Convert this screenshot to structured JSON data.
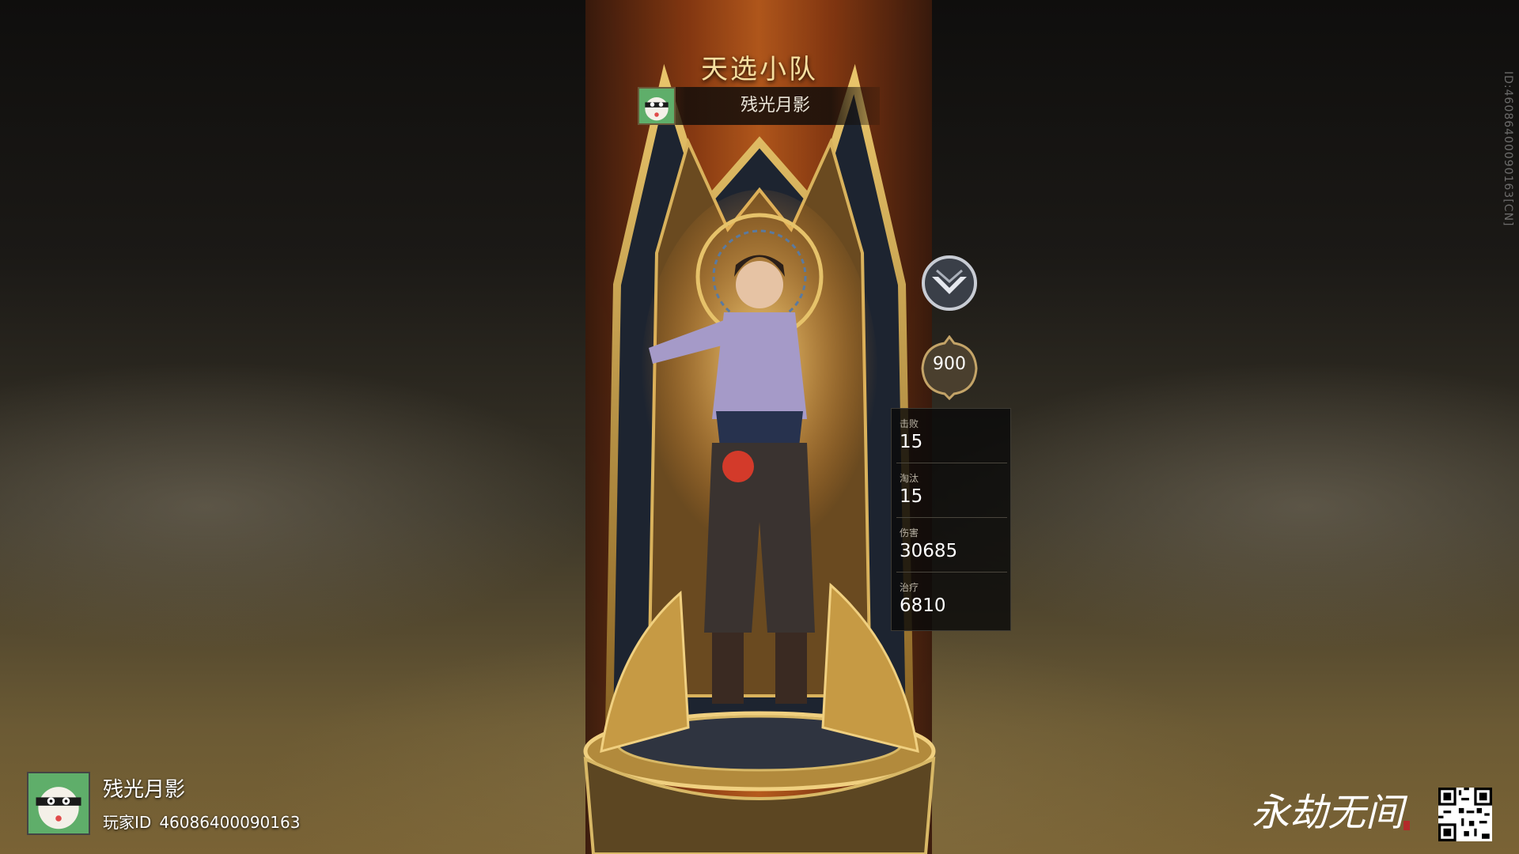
{
  "team": {
    "title": "天选小队",
    "player_name": "残光月影"
  },
  "badges": {
    "rank_icon": "wing-chevron-rank-icon",
    "score": "900"
  },
  "stats": [
    {
      "label": "击败",
      "value": "15"
    },
    {
      "label": "淘汰",
      "value": "15"
    },
    {
      "label": "伤害",
      "value": "30685"
    },
    {
      "label": "治疗",
      "value": "6810"
    }
  ],
  "player": {
    "name": "残光月影",
    "id_label": "玩家ID",
    "id_value": "46086400090163"
  },
  "watermark": "ID:46086400090163[CN]",
  "logo": {
    "text": "永劫无间"
  },
  "colors": {
    "gold": "#f6dfa0",
    "banner": "#b85a1c",
    "panel": "#0a0a0a"
  }
}
